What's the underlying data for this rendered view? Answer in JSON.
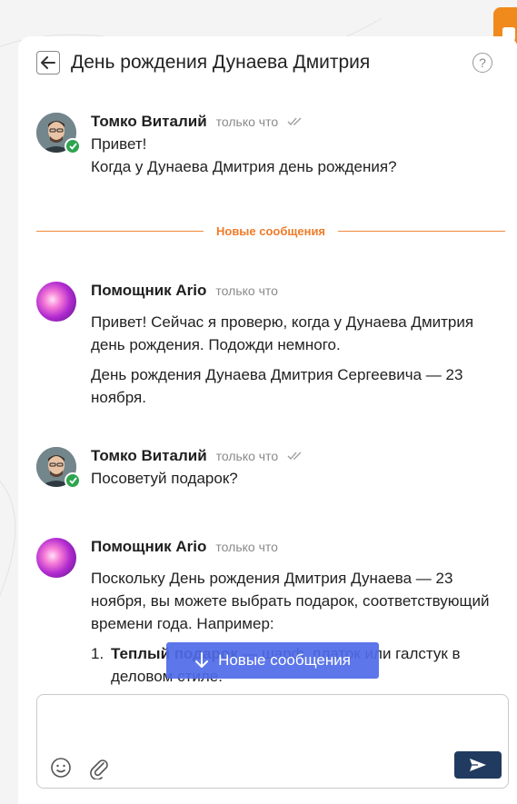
{
  "header": {
    "title": "День рождения Дунаева Дмитрия",
    "help_label": "?"
  },
  "divider": {
    "label": "Новые сообщения"
  },
  "messages": [
    {
      "author": "Томко Виталий",
      "time": "только что",
      "lines": [
        "Привет!",
        "Когда у Дунаева Дмитрия день рождения?"
      ]
    },
    {
      "author": "Помощник Ario",
      "time": "только что",
      "paragraphs": [
        "Привет! Сейчас я проверю, когда у Дунаева Дмитрия день рождения. Подожди немного.",
        "День рождения Дунаева Дмитрия Сергеевича — 23 ноября."
      ]
    },
    {
      "author": "Томко Виталий",
      "time": "только что",
      "lines": [
        "Посоветуй подарок?"
      ]
    },
    {
      "author": "Помощник Ario",
      "time": "только что",
      "paragraphs": [
        "Поскольку День рождения Дмитрия Дунаева — 23 ноября, вы можете выбрать подарок, соответствующий времени года. Например:"
      ],
      "list": [
        {
          "num": "1.",
          "bold": "Теплый подарок",
          "rest": " — шарф, платок или галстук в деловом стиле."
        }
      ]
    }
  ],
  "new_messages_button": {
    "label": "Новые сообщения"
  },
  "composer": {
    "placeholder": "",
    "value": ""
  },
  "icons": {
    "back": "arrow-left-icon",
    "help": "question-icon",
    "read": "double-check-icon",
    "online": "check-icon",
    "emoji": "smiley-icon",
    "attach": "paperclip-icon",
    "send": "send-icon",
    "scroll": "arrow-down-icon"
  },
  "colors": {
    "accent_orange": "#f08a1c",
    "divider_orange": "#ef7c2a",
    "online_green": "#2ea44f",
    "new_msg_blue": "#4f6be8",
    "send_navy": "#213a5f"
  }
}
